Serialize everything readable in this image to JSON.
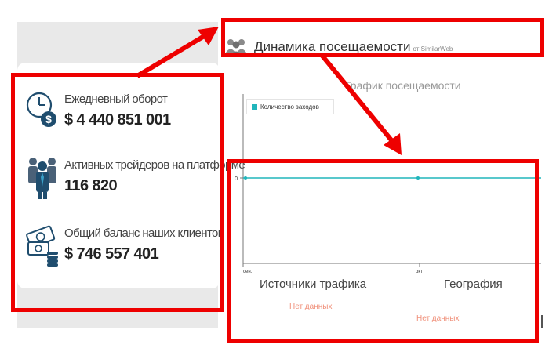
{
  "stats": [
    {
      "icon": "clock-dollar-icon",
      "label": "Ежедневный оборот",
      "value": "$ 4 440 851 001"
    },
    {
      "icon": "traders-group-icon",
      "label": "Активных трейдеров на платформе",
      "value": "116 820"
    },
    {
      "icon": "money-coins-icon",
      "label": "Общий баланс наших клиентов",
      "value": "$ 746 557 401"
    }
  ],
  "traffic": {
    "icon": "users-icon",
    "title": "Динамика посещаемости",
    "source": "от SimilarWeb",
    "chart_title": "График посещаемости",
    "legend_label": "Количество заходов",
    "y_tick": "0",
    "x_ticks": [
      "сен.",
      "окт"
    ]
  },
  "sources": {
    "title": "Источники трафика",
    "empty": "Нет данных"
  },
  "geography": {
    "title": "География",
    "empty": "Нет данных"
  },
  "colors": {
    "highlight": "#ee0000",
    "series": "#20b5bb",
    "empty_text": "#f0907a"
  },
  "chart_data": {
    "type": "line",
    "title": "График посещаемости",
    "x": [
      "сен.",
      "окт"
    ],
    "series": [
      {
        "name": "Количество заходов",
        "values": [
          0,
          0
        ]
      }
    ],
    "yticks": [
      "0"
    ],
    "legend": "top-left"
  }
}
